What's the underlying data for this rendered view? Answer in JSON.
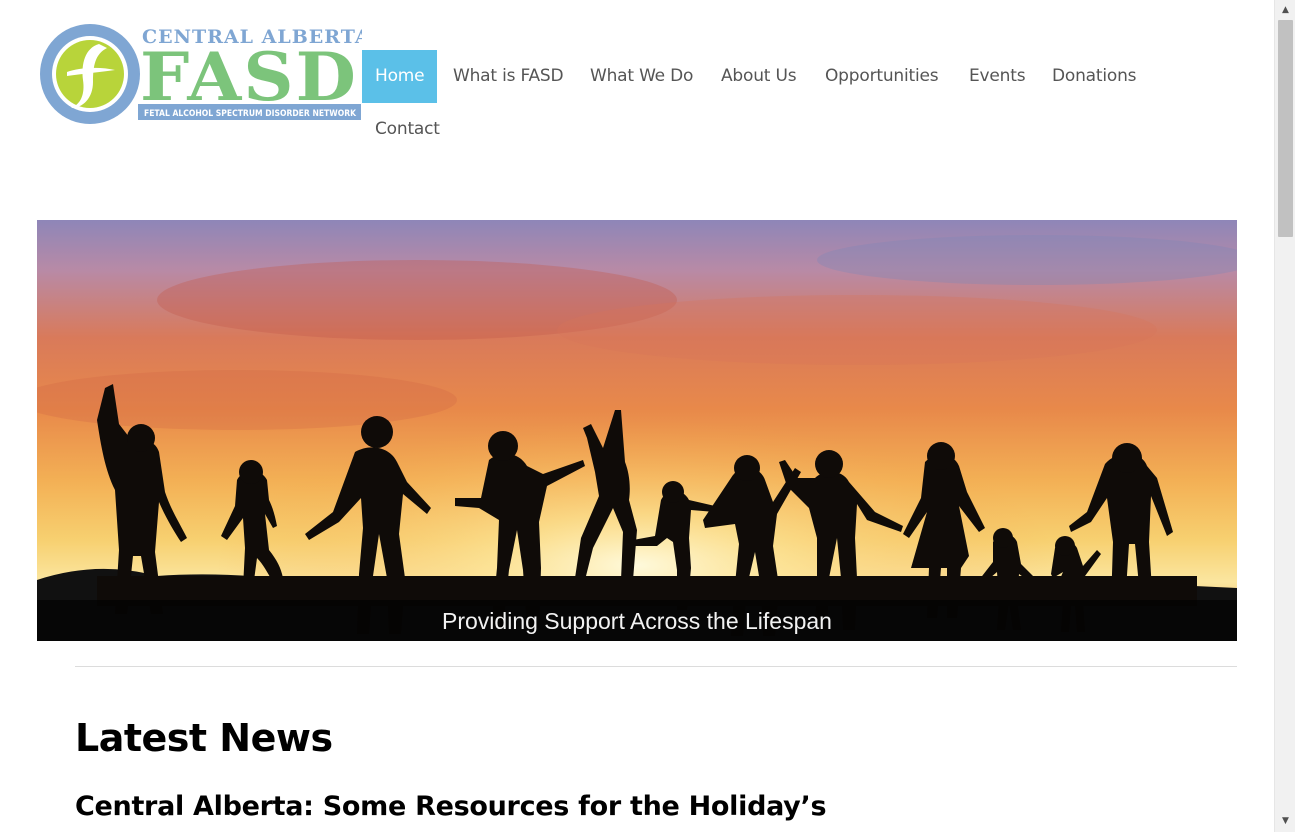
{
  "logo": {
    "top_text": "CENTRAL ALBERTA",
    "main_text": "FASD",
    "banner_text": "FETAL ALCOHOL SPECTRUM DISORDER NETWORK",
    "colors": {
      "circle": "#7fa6d3",
      "inner": "#b8d43a",
      "text_blue": "#7fa6d3",
      "text_green": "#7cc47b",
      "banner": "#7fa6d3"
    }
  },
  "nav": {
    "items": [
      {
        "label": "Home",
        "active": true
      },
      {
        "label": "What is FASD"
      },
      {
        "label": "What We Do"
      },
      {
        "label": "About Us"
      },
      {
        "label": "Opportunities"
      },
      {
        "label": "Events"
      },
      {
        "label": "Donations"
      },
      {
        "label": "Contact"
      }
    ],
    "active_color": "#5bc0e8"
  },
  "hero": {
    "caption": "Providing Support Across the Lifespan"
  },
  "main": {
    "section_title": "Latest News",
    "post_title": "Central Alberta: Some Resources for the Holiday’s"
  },
  "scrollbar": {
    "up_glyph": "▲",
    "down_glyph": "▼"
  }
}
